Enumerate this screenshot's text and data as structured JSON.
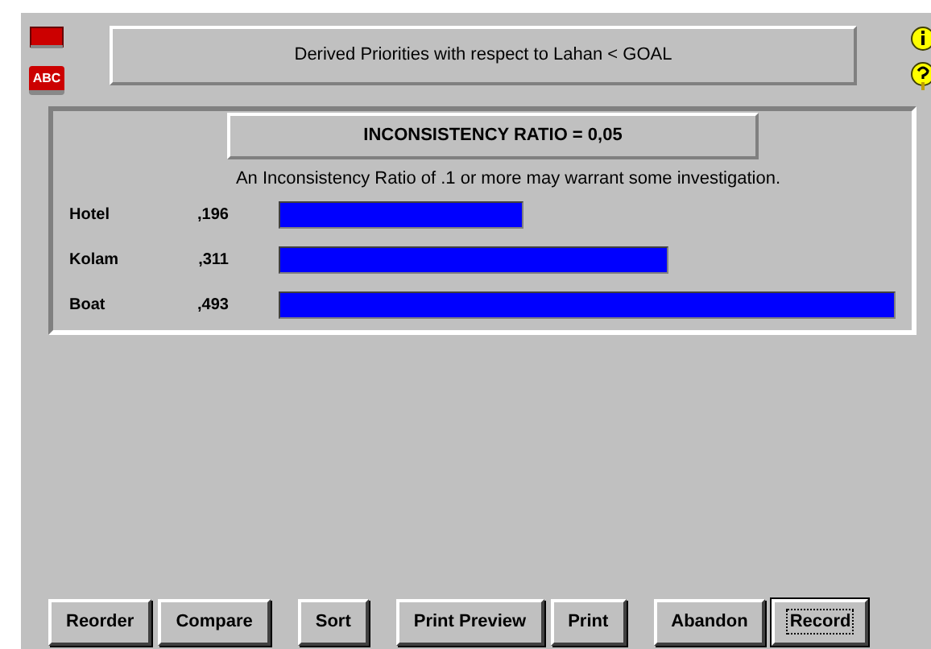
{
  "header": {
    "title": "Derived Priorities with respect to Lahan < GOAL"
  },
  "panel": {
    "ratio": "INCONSISTENCY RATIO = 0,05",
    "note": "An Inconsistency Ratio of .1 or more may warrant some investigation.",
    "rows": [
      {
        "label": "Hotel",
        "value": ",196"
      },
      {
        "label": "Kolam",
        "value": ",311"
      },
      {
        "label": "Boat",
        "value": ",493"
      }
    ]
  },
  "side_icons": [
    {
      "kind": "book"
    },
    {
      "kind": "abc",
      "text": "ABC"
    }
  ],
  "button_groups": [
    [
      {
        "label": "Reorder",
        "default": false
      },
      {
        "label": "Compare",
        "default": false
      }
    ],
    [
      {
        "label": "Sort",
        "default": false
      }
    ],
    [
      {
        "label": "Print Preview",
        "default": false
      },
      {
        "label": "Print",
        "default": false
      }
    ],
    [
      {
        "label": "Abandon",
        "default": false
      },
      {
        "label": "Record",
        "default": true
      }
    ]
  ]
}
